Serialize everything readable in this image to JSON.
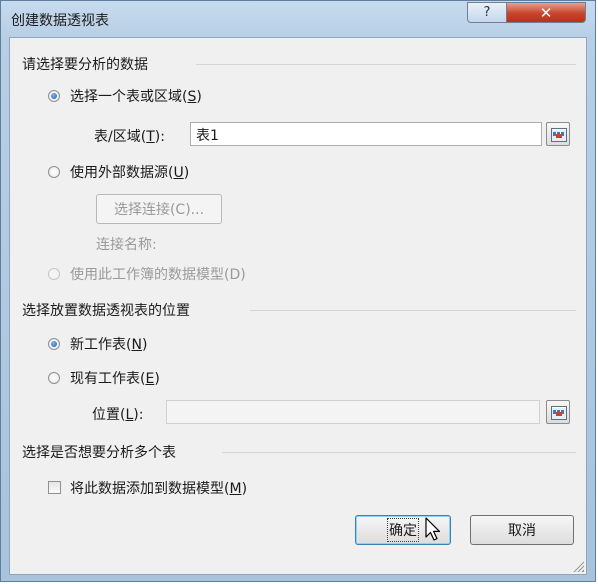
{
  "dialog": {
    "title": "创建数据透视表",
    "help_glyph": "?",
    "close_glyph": "✕"
  },
  "section1": {
    "title": "请选择要分析的数据",
    "option_table": {
      "label": "选择一个表或区域(",
      "key": "S",
      "tail": ")",
      "checked": true
    },
    "range_label": {
      "label": "表/区域(",
      "key": "T",
      "tail": "):"
    },
    "range_value": "表1",
    "option_external": {
      "label": "使用外部数据源(",
      "key": "U",
      "tail": ")",
      "checked": false
    },
    "choose_connection_button": "选择连接(C)...",
    "connection_name_label": "连接名称:",
    "option_model": {
      "label": "使用此工作簿的数据模型(D)",
      "checked": false,
      "disabled": true
    }
  },
  "section2": {
    "title": "选择放置数据透视表的位置",
    "option_new_sheet": {
      "label": "新工作表(",
      "key": "N",
      "tail": ")",
      "checked": true
    },
    "option_existing_sheet": {
      "label": "现有工作表(",
      "key": "E",
      "tail": ")",
      "checked": false
    },
    "location_label": {
      "label": "位置(",
      "key": "L",
      "tail": "):"
    },
    "location_value": ""
  },
  "section3": {
    "title": "选择是否想要分析多个表",
    "add_to_model": {
      "label": "将此数据添加到数据模型(",
      "key": "M",
      "tail": ")",
      "checked": false
    }
  },
  "buttons": {
    "ok": "确定",
    "cancel": "取消"
  }
}
